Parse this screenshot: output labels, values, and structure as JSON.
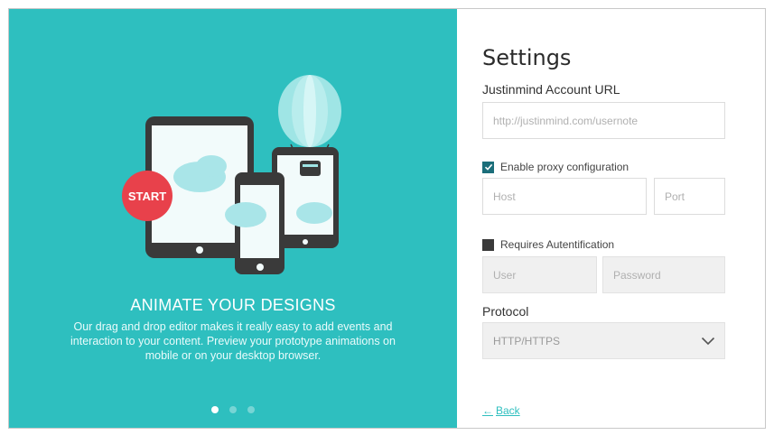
{
  "hero": {
    "badge": "START",
    "title": "ANIMATE YOUR DESIGNS",
    "description": "Our drag and drop editor makes it really easy to add events and interaction to your content. Preview your prototype animations on mobile or on your desktop browser.",
    "pager_count": 3,
    "pager_active": 0
  },
  "settings": {
    "title": "Settings",
    "account_url_label": "Justinmind Account URL",
    "account_url_placeholder": "http://justinmind.com/usernote",
    "proxy_label": "Enable proxy configuration",
    "proxy_checked": true,
    "host_placeholder": "Host",
    "port_placeholder": "Port",
    "auth_label": "Requires Autentification",
    "auth_checked": false,
    "user_placeholder": "User",
    "password_placeholder": "Password",
    "protocol_label": "Protocol",
    "protocol_value": "HTTP/HTTPS",
    "back_label": "Back"
  },
  "colors": {
    "teal": "#2ebfbf",
    "start_red": "#e8414b",
    "device_dark": "#3a3a3a",
    "checkbox_checked": "#1b6e7a"
  }
}
